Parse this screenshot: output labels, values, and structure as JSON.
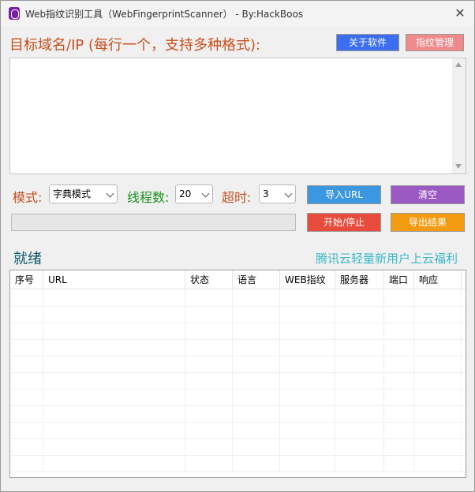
{
  "window": {
    "title": "Web指纹识别工具（WebFingerprintScanner）   -   By:HackBoos",
    "close_glyph": "✕"
  },
  "input_section": {
    "label": "目标域名/IP (每行一个，支持多种格式):",
    "value": ""
  },
  "header_buttons": {
    "about": "关于软件",
    "fingerprint_manage": "指纹管理"
  },
  "options": {
    "mode_label": "模式:",
    "mode_value": "字典模式",
    "threads_label": "线程数:",
    "threads_value": "20",
    "timeout_label": "超时:",
    "timeout_value": "3"
  },
  "actions": {
    "import_url": "导入URL",
    "clear": "清空",
    "start_stop": "开始/停止",
    "export": "导出结果"
  },
  "progress": {
    "percent": 0
  },
  "status": {
    "text": "就绪",
    "promo": "腾讯云轻量新用户上云福利"
  },
  "table": {
    "columns": [
      "序号",
      "URL",
      "状态",
      "语言",
      "WEB指纹",
      "服务器",
      "端口",
      "响应"
    ],
    "rows": []
  },
  "colors": {
    "accent_orange": "#c8501f",
    "accent_green": "#1a8f1a",
    "about_btn": "#3c6ef2",
    "manage_btn": "#f08a8a",
    "import_btn": "#3a97e0",
    "clear_btn": "#9b59c4",
    "start_btn": "#e74c3c",
    "export_btn": "#f39c12",
    "status_text": "#0b5a6b",
    "promo_text": "#3cb8c8"
  }
}
